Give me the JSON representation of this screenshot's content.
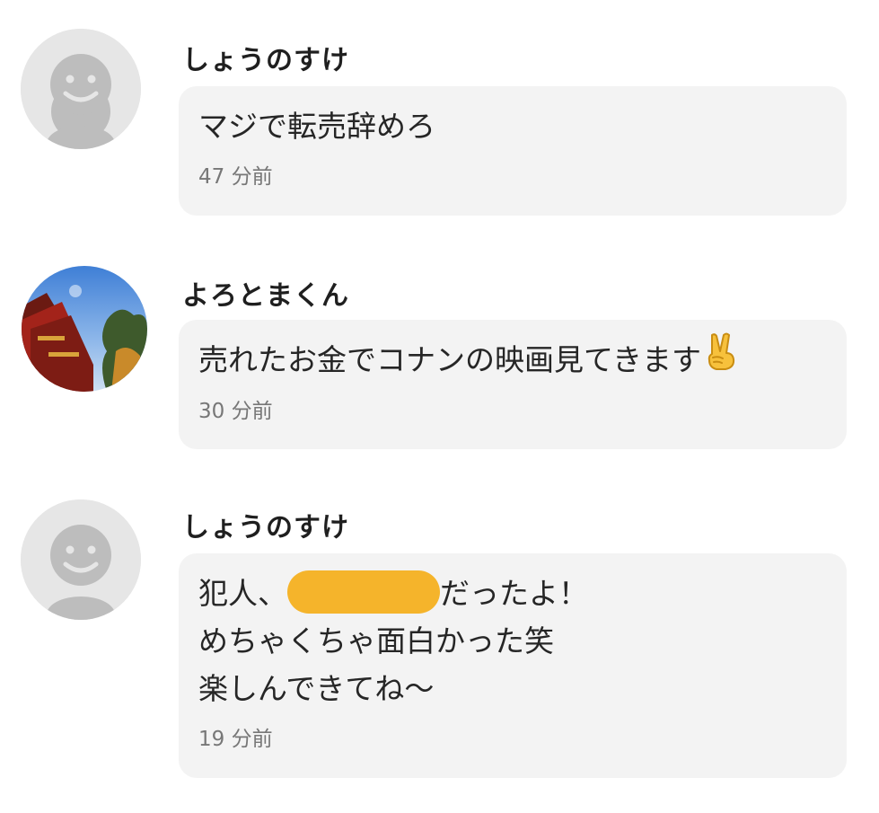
{
  "colors": {
    "redaction": "#f5b42b",
    "bubble_bg": "#f3f3f3",
    "avatar_default_bg": "#e6e6e6",
    "avatar_default_figure": "#bdbdbd"
  },
  "comments": [
    {
      "username": "しょうのすけ",
      "avatar": "default-user-icon",
      "message_lines": [
        "マジで転売辞めろ"
      ],
      "timestamp": "47 分前"
    },
    {
      "username": "よろとまくん",
      "avatar": "photo-avatar",
      "message_text": "売れたお金でコナンの映画見てきます",
      "message_emoji": "victory-hand-icon",
      "timestamp": "30 分前"
    },
    {
      "username": "しょうのすけ",
      "avatar": "default-user-icon",
      "message_line1_before": "犯人、",
      "message_line1_after": "だったよ！",
      "message_lines": [
        "めちゃくちゃ面白かった笑",
        "楽しんできてね〜"
      ],
      "timestamp": "19 分前"
    }
  ]
}
